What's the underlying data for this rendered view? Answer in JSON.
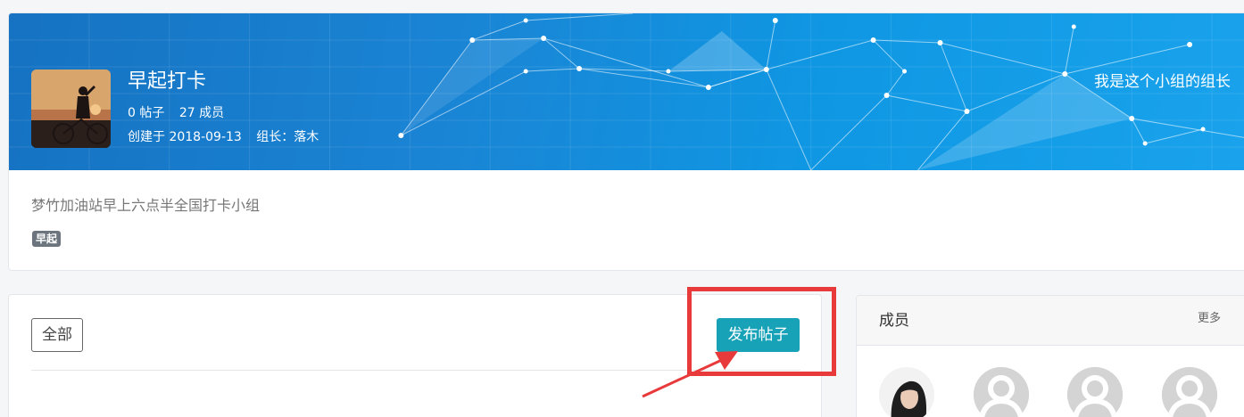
{
  "group": {
    "name": "早起打卡",
    "posts": "0 帖子",
    "members": "27 成员",
    "created": "创建于 2018-09-13",
    "leader": "组长：落木",
    "leader_note": "我是这个小组的组长",
    "description": "梦竹加油站早上六点半全国打卡小组",
    "tag": "早起",
    "banner_color": "#1a84d4"
  },
  "posts_panel": {
    "filter_label": "全部",
    "publish_label": "发布帖子",
    "publish_color": "#17a2b8"
  },
  "members_panel": {
    "title": "成员",
    "more_label": "更多",
    "avatars": [
      "photo-avatar",
      "default-avatar",
      "default-avatar",
      "default-avatar"
    ]
  },
  "annotation": {
    "color": "#e8393b"
  }
}
